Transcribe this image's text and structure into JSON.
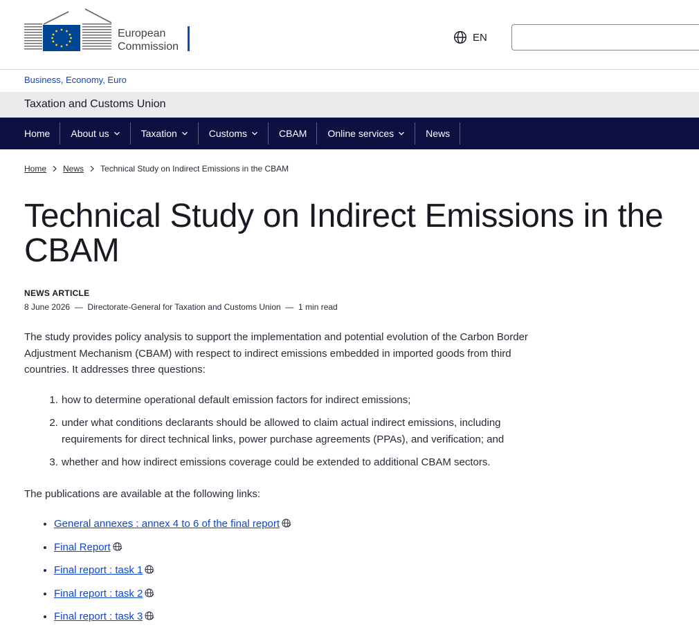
{
  "header": {
    "logo_line1": "European",
    "logo_line2": "Commission",
    "language": "EN",
    "search_placeholder": ""
  },
  "site": {
    "parent_link": "Business, Economy, Euro",
    "name": "Taxation and Customs Union"
  },
  "nav": {
    "items": [
      {
        "label": "Home"
      },
      {
        "label": "About us"
      },
      {
        "label": "Taxation"
      },
      {
        "label": "Customs"
      },
      {
        "label": "CBAM"
      },
      {
        "label": "Online services"
      },
      {
        "label": "News"
      }
    ]
  },
  "breadcrumb": {
    "home": "Home",
    "news": "News",
    "current": "Technical Study on Indirect Emissions in the CBAM"
  },
  "article": {
    "title": "Technical Study on Indirect Emissions in the CBAM",
    "type": "NEWS ARTICLE",
    "date": "8 June 2026",
    "author": "Directorate-General for Taxation and Customs Union",
    "read_time": "1 min read",
    "intro": "The study provides policy analysis to support the implementation and potential evolution of the Carbon Border Adjustment Mechanism (CBAM) with respect to indirect emissions embedded in imported goods from third countries. It addresses three questions:",
    "questions": [
      "how to determine operational default emission factors for indirect emissions;",
      "under what conditions declarants should be allowed to claim actual indirect emissions, including requirements for direct technical links, power purchase agreements (PPAs), and verification; and",
      "whether and how indirect emissions coverage could be extended to additional CBAM sectors."
    ],
    "publications_intro": "The publications are available at the following links:",
    "links": [
      "General annexes : annex 4 to 6 of the final report",
      "Final Report",
      "Final report : task 1",
      "Final report : task 2",
      "Final report : task 3"
    ]
  },
  "colors": {
    "nav_bg": "#0c1141",
    "link": "#0e47cb",
    "site_band": "#eaebed"
  }
}
